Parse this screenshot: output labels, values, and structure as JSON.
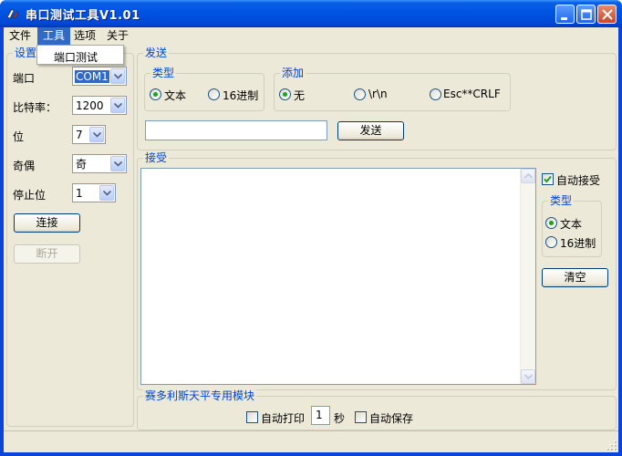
{
  "window": {
    "title": "串口测试工具V1.01"
  },
  "menu": {
    "items": [
      {
        "label": "文件"
      },
      {
        "label": "工具"
      },
      {
        "label": "选项"
      },
      {
        "label": "关于"
      }
    ],
    "dropdown": {
      "item": "端口测试"
    }
  },
  "settings": {
    "group_label": "设置",
    "port_label": "端口",
    "port_value": "COM1",
    "baud_label": "比特率：",
    "baud_value": "1200",
    "bits_label": "位",
    "bits_value": "7",
    "parity_label": "奇偶",
    "parity_value": "奇",
    "stop_label": "停止位",
    "stop_value": "1",
    "connect_label": "连接",
    "disconnect_label": "断开"
  },
  "send": {
    "group_label": "发送",
    "type_group": "类型",
    "type_text": "文本",
    "type_hex": "16进制",
    "append_group": "添加",
    "append_none": "无",
    "append_rn": "\\r\\n",
    "append_crlf": "Esc**CRLF",
    "input_value": "",
    "send_label": "发送"
  },
  "receive": {
    "group_label": "接受",
    "auto_label": "自动接受",
    "type_group": "类型",
    "type_text": "文本",
    "type_hex": "16进制",
    "clear_label": "清空"
  },
  "module": {
    "group_label": "赛多利斯天平专用模块",
    "auto_print": "自动打印",
    "interval_value": "1",
    "seconds": "秒",
    "auto_save": "自动保存"
  },
  "colors": {
    "title_bar": "#0053e1",
    "accent": "#0046d5",
    "selection": "#316ac5",
    "client": "#ece9d8"
  }
}
